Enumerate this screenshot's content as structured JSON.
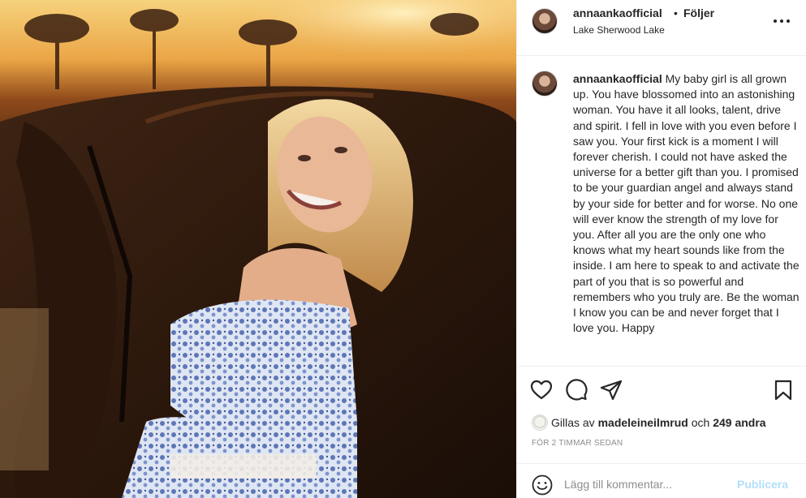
{
  "post": {
    "photo_alt": "Young blonde woman in a blue floral off-shoulder top smiling, leaning against a dark brown horse at sunset",
    "username": "annaankaofficial",
    "separator": "•",
    "follow_label": "Följer",
    "location": "Lake Sherwood Lake",
    "caption_text": "My baby girl is all grown up. You have blossomed into an astonishing woman. You have it all looks, talent, drive and spirit. I fell in love with you even before I saw you. Your first kick is a moment I will forever cherish. I could not have asked the universe for a better gift than you. I promised to be your guardian angel and always stand by your side for better and for worse. No one will ever know the strength of my love for you. After all you are the only one who knows what my heart sounds like from the inside. I am here to speak to and activate the part of you that is so powerful and remembers who you truly are. Be the woman I know you can be and never forget that I love you. Happy",
    "likes": {
      "prefix": "Gillas av",
      "user": "madeleineilmrud",
      "conjunction": "och",
      "count": "249 andra"
    },
    "timestamp": "FÖR 2 TIMMAR SEDAN"
  },
  "comment_box": {
    "placeholder": "Lägg till kommentar...",
    "publish_label": "Publicera"
  },
  "icons": {
    "more": "more-options-icon",
    "like": "heart-icon",
    "comment": "comment-bubble-icon",
    "share": "paper-plane-icon",
    "save": "bookmark-icon",
    "emoji": "smiley-icon"
  },
  "colors": {
    "text": "#262626",
    "secondary": "#8e8e8e",
    "publish_disabled": "#b2dffc",
    "border": "#efefef"
  }
}
